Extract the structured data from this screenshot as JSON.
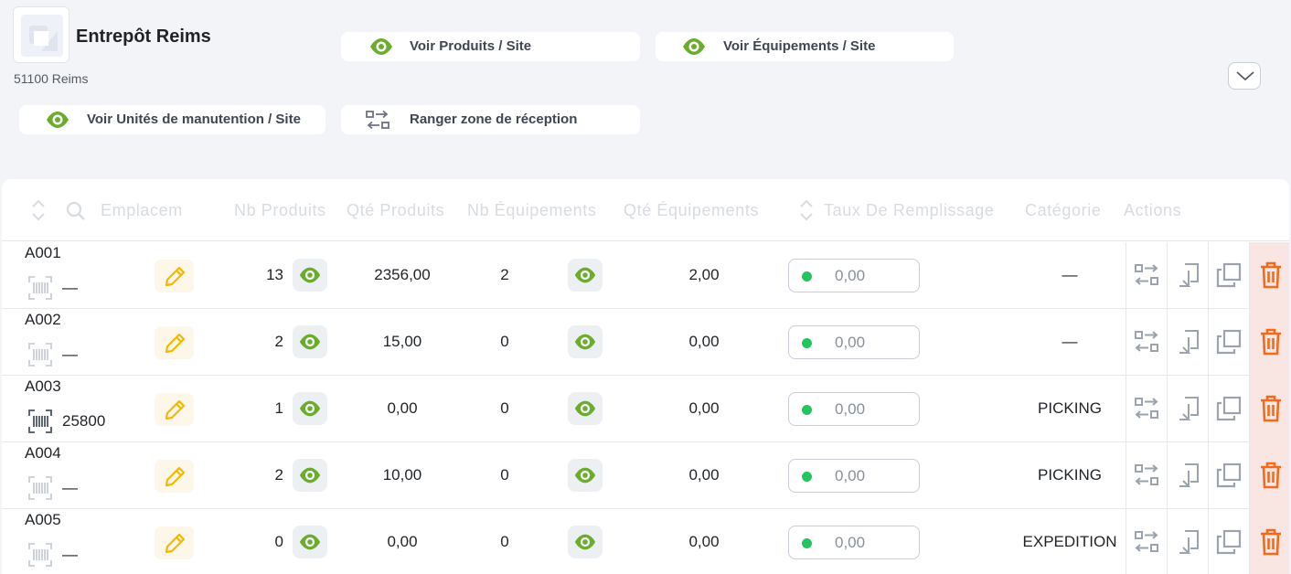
{
  "site": {
    "name": "Entrepôt Reims",
    "address": "51100 Reims"
  },
  "actions": {
    "view_products": "Voir Produits / Site",
    "view_equipments": "Voir Équipements / Site",
    "view_handling_units": "Voir Unités de manutention / Site",
    "store_reception": "Ranger zone de réception"
  },
  "table": {
    "headers": {
      "location": "Emplacem",
      "nb_products": "Nb Produits",
      "qty_products": "Qté Produits",
      "nb_equipments": "Nb Équipements",
      "qty_equipments": "Qté Équipements",
      "fill_rate": "Taux De Remplissage",
      "category": "Catégorie",
      "actions": "Actions"
    },
    "rows": [
      {
        "code": "A001",
        "barcode": "—",
        "nb_products": "13",
        "qty_products": "2356,00",
        "nb_equipments": "2",
        "qty_equipments": "2,00",
        "fill_rate": "0,00",
        "category": "—"
      },
      {
        "code": "A002",
        "barcode": "—",
        "nb_products": "2",
        "qty_products": "15,00",
        "nb_equipments": "0",
        "qty_equipments": "0,00",
        "fill_rate": "0,00",
        "category": "—"
      },
      {
        "code": "A003",
        "barcode": "25800",
        "nb_products": "1",
        "qty_products": "0,00",
        "nb_equipments": "0",
        "qty_equipments": "0,00",
        "fill_rate": "0,00",
        "category": "PICKING"
      },
      {
        "code": "A004",
        "barcode": "—",
        "nb_products": "2",
        "qty_products": "10,00",
        "nb_equipments": "0",
        "qty_equipments": "0,00",
        "fill_rate": "0,00",
        "category": "PICKING"
      },
      {
        "code": "A005",
        "barcode": "—",
        "nb_products": "0",
        "qty_products": "0,00",
        "nb_equipments": "0",
        "qty_equipments": "0,00",
        "fill_rate": "0,00",
        "category": "EXPEDITION"
      }
    ]
  },
  "colors": {
    "accent_green": "#6aac2b",
    "edit_yellow": "#f5b700",
    "delete_orange": "#f26b1d",
    "status_green": "#22c55e"
  },
  "icons": {
    "eye": "eye-icon",
    "transfer": "transfer-arrows-icon",
    "edit": "pencil-icon",
    "barcode": "barcode-scan-icon",
    "move": "move-return-icon",
    "duplicate": "duplicate-icon",
    "delete": "trash-icon",
    "sort": "sort-icon",
    "search": "search-icon",
    "chevron": "chevron-down-icon"
  }
}
